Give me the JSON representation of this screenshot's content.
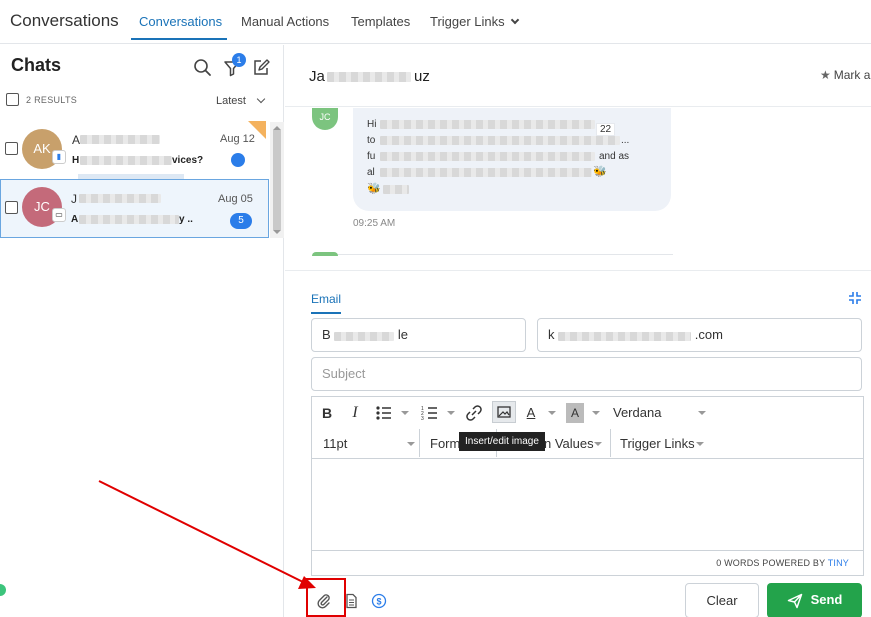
{
  "app": {
    "title": "Conversations"
  },
  "nav": {
    "tabs": [
      {
        "label": "Conversations",
        "active": true
      },
      {
        "label": "Manual Actions"
      },
      {
        "label": "Templates"
      },
      {
        "label": "Trigger Links"
      }
    ]
  },
  "chats": {
    "title": "Chats",
    "filter_badge": "1",
    "results_label": "2 RESULTS",
    "sort_label": "Latest",
    "items": [
      {
        "initials": "AK",
        "name_visible": "A",
        "preview_tail": "vices?",
        "preview_head": "H",
        "date": "Aug 12",
        "unread": "",
        "avatar_color": "#c8a06b"
      },
      {
        "initials": "JC",
        "name_visible": "J",
        "preview_tail": "y ..",
        "preview_head": "A",
        "date": "Aug 05",
        "unread": "5",
        "avatar_color": "#c46a7a"
      }
    ]
  },
  "conversation": {
    "contact_head": "Ja",
    "contact_tail": "uz",
    "mark_as": "Mark a",
    "message": {
      "avatar": "JC",
      "line1_head": "Hi",
      "line1_tail": "22",
      "line2_head": "to",
      "line2_tail": "...",
      "line3_head": "fu",
      "line3_tail": "and as",
      "line4_head": "al",
      "time": "09:25 AM"
    }
  },
  "composer": {
    "tab_label": "Email",
    "from_value_head": "B",
    "from_value_tail": "le",
    "to_value_head": "k",
    "to_value_tail": ".com",
    "subject_placeholder": "Subject",
    "toolbar": {
      "bold": "B",
      "italic": "I",
      "font_family": "Verdana",
      "font_size": "11pt",
      "formats": "Form",
      "custom_values_tail": "n Values",
      "trigger_links": "Trigger Links",
      "tooltip": "Insert/edit image"
    },
    "status_words": "0 WORDS POWERED BY",
    "status_brand": "TINY",
    "clear_label": "Clear",
    "send_label": "Send"
  },
  "colors": {
    "accent": "#1a73b8",
    "send": "#23a34b",
    "badge": "#2b7de9",
    "annotation": "#e00000"
  }
}
